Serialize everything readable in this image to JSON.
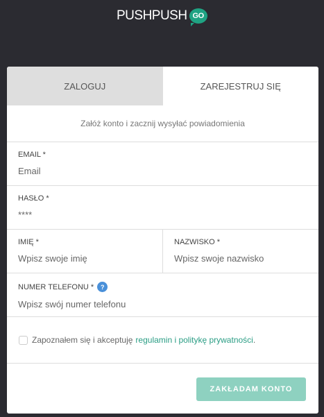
{
  "logo": {
    "text": "PUSHPUSH",
    "badge": "GO"
  },
  "tabs": {
    "login": "ZALOGUJ",
    "register": "ZAREJESTRUJ SIĘ"
  },
  "subtitle": "Załóż konto i zacznij wysyłać powiadomienia",
  "fields": {
    "email": {
      "label": "EMAIL *",
      "placeholder": "Email"
    },
    "password": {
      "label": "HASŁO *",
      "value": "****"
    },
    "first_name": {
      "label": "IMIĘ *",
      "placeholder": "Wpisz swoje imię"
    },
    "last_name": {
      "label": "NAZWISKO *",
      "placeholder": "Wpisz swoje nazwisko"
    },
    "phone": {
      "label": "NUMER TELEFONU *",
      "help": "?",
      "placeholder": "Wpisz swój numer telefonu"
    }
  },
  "terms": {
    "text": "Zapoznałem się i akceptuję",
    "link": "regulamin i politykę prywatności",
    "end": "."
  },
  "submit": "ZAKŁADAM KONTO"
}
